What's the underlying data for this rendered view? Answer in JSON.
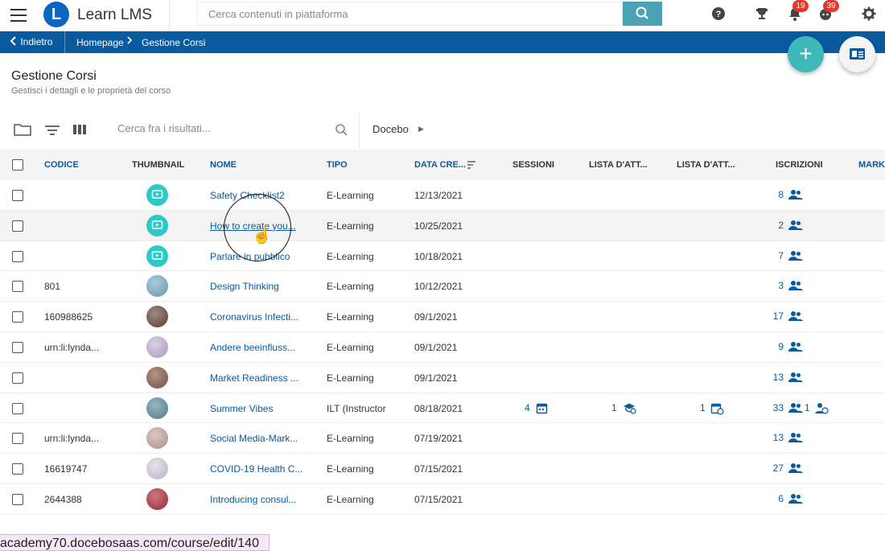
{
  "header": {
    "app_name": "Learn LMS",
    "logo_letter": "L",
    "search_placeholder": "Cerca contenuti in piattaforma",
    "notifications_count": "19",
    "messages_count": "39"
  },
  "breadcrumb": {
    "back_label": "Indietro",
    "home_label": "Homepage",
    "current_label": "Gestione Corsi"
  },
  "page": {
    "title": "Gestione Corsi",
    "subtitle": "Gestisci i dettagli e le proprietà del corso"
  },
  "toolbar": {
    "search_placeholder": "Cerca fra i risultati...",
    "catalog_label": "Docebo"
  },
  "table": {
    "columns": {
      "code": "CODICE",
      "thumbnail": "THUMBNAIL",
      "name": "NOME",
      "type": "TIPO",
      "created": "DATA CRE...",
      "sessions": "SESSIONI",
      "waitlist1": "LISTA D'ATT...",
      "waitlist2": "LISTA D'ATT...",
      "enrollments": "ISCRIZIONI",
      "more": "MARK"
    },
    "rows": [
      {
        "code": "",
        "name": "Safety Checklist2",
        "type": "E-Learning",
        "date": "12/13/2021",
        "enrollments": "8",
        "thumb": "elearning"
      },
      {
        "code": "",
        "name": "How to create you...",
        "type": "E-Learning",
        "date": "10/25/2021",
        "enrollments": "2",
        "thumb": "elearning"
      },
      {
        "code": "",
        "name": "Parlare in pubblico",
        "type": "E-Learning",
        "date": "10/18/2021",
        "enrollments": "7",
        "thumb": "elearning"
      },
      {
        "code": "801",
        "name": "Design Thinking",
        "type": "E-Learning",
        "date": "10/12/2021",
        "enrollments": "3",
        "thumb": "photo"
      },
      {
        "code": "160988625",
        "name": "Coronavirus Infecti...",
        "type": "E-Learning",
        "date": "09/1/2021",
        "enrollments": "17",
        "thumb": "photo"
      },
      {
        "code": "urn:li:lynda...",
        "name": "Andere beeinfluss...",
        "type": "E-Learning",
        "date": "09/1/2021",
        "enrollments": "9",
        "thumb": "photo"
      },
      {
        "code": "",
        "name": "Market Readiness ...",
        "type": "E-Learning",
        "date": "09/1/2021",
        "enrollments": "13",
        "thumb": "photo"
      },
      {
        "code": "",
        "name": "Summer Vibes",
        "type": "ILT (Instructor",
        "date": "08/18/2021",
        "enrollments": "33",
        "sessions": "4",
        "waitlist1": "1",
        "waitlist2": "1",
        "extra": "1",
        "thumb": "photo"
      },
      {
        "code": "urn:li:lynda...",
        "name": "Social Media-Mark...",
        "type": "E-Learning",
        "date": "07/19/2021",
        "enrollments": "13",
        "thumb": "photo"
      },
      {
        "code": "16619747",
        "name": "COVID-19 Health C...",
        "type": "E-Learning",
        "date": "07/15/2021",
        "enrollments": "27",
        "thumb": "photo"
      },
      {
        "code": "2644388",
        "name": "Introducing consul...",
        "type": "E-Learning",
        "date": "07/15/2021",
        "enrollments": "6",
        "thumb": "photo"
      }
    ]
  },
  "status_url": "academy70.docebosaas.com/course/edit/140",
  "colors": {
    "brand_blue": "#0a5aa0",
    "teal": "#3fb8b8",
    "badge_red": "#e03a2e"
  }
}
